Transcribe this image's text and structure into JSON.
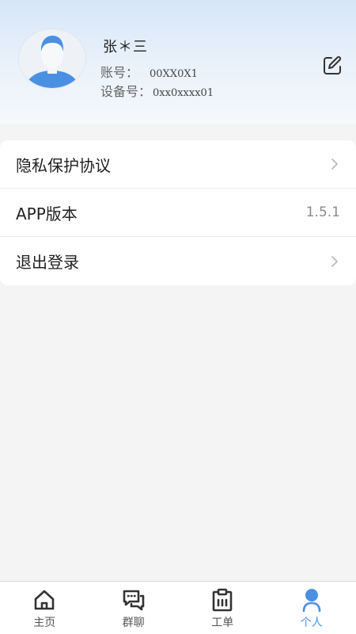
{
  "profile": {
    "name": "张＊三",
    "account_label": "账号：",
    "account_value": "00XX0X1",
    "device_label": "设备号：",
    "device_value": "0xx0xxxx01",
    "avatar_icon": "user-avatar-icon",
    "edit_icon": "edit-icon"
  },
  "menu": {
    "items": [
      {
        "label": "隐私保护协议",
        "value": "",
        "icon": "chevron-right-icon"
      },
      {
        "label": "APP版本",
        "value": "1.5.1",
        "icon": ""
      },
      {
        "label": "退出登录",
        "value": "",
        "icon": "chevron-right-icon"
      }
    ]
  },
  "tabs": [
    {
      "label": "主页",
      "icon": "home-icon",
      "active": false
    },
    {
      "label": "群聊",
      "icon": "chat-icon",
      "active": false
    },
    {
      "label": "工单",
      "icon": "clipboard-icon",
      "active": false
    },
    {
      "label": "个人",
      "icon": "person-icon",
      "active": true
    }
  ],
  "colors": {
    "accent": "#4a90e2",
    "header_top": "#d6e6f8",
    "background": "#f4f4f4"
  }
}
